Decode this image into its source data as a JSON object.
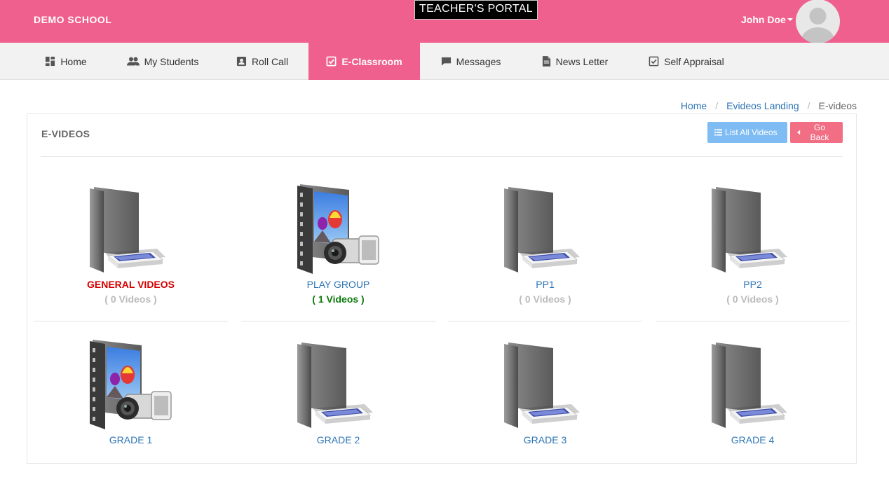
{
  "header": {
    "school_name": "DEMO SCHOOL",
    "portal_title": "TEACHER'S PORTAL",
    "user_name": "John Doe"
  },
  "nav": [
    {
      "label": "Home",
      "icon": "dashboard-icon"
    },
    {
      "label": "My Students",
      "icon": "people-icon"
    },
    {
      "label": "Roll Call",
      "icon": "contact-card-icon"
    },
    {
      "label": "E-Classroom",
      "icon": "checkbox-icon",
      "active": true
    },
    {
      "label": "Messages",
      "icon": "chat-bubble-icon"
    },
    {
      "label": "News Letter",
      "icon": "document-icon"
    },
    {
      "label": "Self Appraisal",
      "icon": "checkbox-icon"
    }
  ],
  "breadcrumb": [
    "Home",
    "Evideos Landing",
    "E-videos"
  ],
  "panel": {
    "title": "E-VIDEOS",
    "list_all_label": "List All Videos",
    "go_back_label": "Go Back"
  },
  "folders": [
    {
      "name": "GENERAL VIDEOS",
      "count": "( 0 Videos )",
      "icon": "empty-folder-icon"
    },
    {
      "name": "PLAY GROUP",
      "count": "( 1 Videos )",
      "icon": "video-folder-icon"
    },
    {
      "name": "PP1",
      "count": "( 0 Videos )",
      "icon": "empty-folder-icon"
    },
    {
      "name": "PP2",
      "count": "( 0 Videos )",
      "icon": "empty-folder-icon"
    },
    {
      "name": "GRADE 1",
      "icon": "video-folder-icon"
    },
    {
      "name": "GRADE 2",
      "icon": "empty-folder-icon"
    },
    {
      "name": "GRADE 3",
      "icon": "empty-folder-icon"
    },
    {
      "name": "GRADE 4",
      "icon": "empty-folder-icon"
    }
  ],
  "colors": {
    "brand_pink": "#f0608e",
    "link_blue": "#2e75b6",
    "highlight_red": "#d50000",
    "count_green": "#0b7a0b"
  }
}
